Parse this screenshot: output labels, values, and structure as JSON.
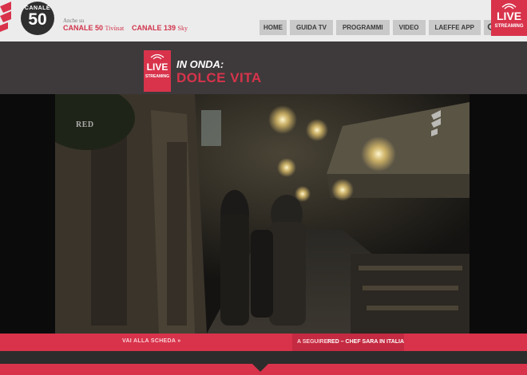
{
  "header": {
    "logo_icon": "la-logo-icon",
    "badge": {
      "top": "CANALE",
      "number": "50"
    },
    "anche_su": "Anche su",
    "channels": [
      {
        "name": "CANALE 50",
        "platform": "Tivùsat"
      },
      {
        "name": "CANALE 139",
        "platform": "Sky"
      }
    ],
    "nav": [
      "HOME",
      "GUIDA TV",
      "PROGRAMMI",
      "VIDEO",
      "LAEFFE APP"
    ],
    "search_icon": "search-icon",
    "live_streaming": {
      "top": "LIVE",
      "bottom": "STREAMING"
    }
  },
  "band": {
    "live_box": {
      "top": "LIVE",
      "bottom": "STREAMING"
    },
    "in_onda": "IN ONDA:",
    "title": "DOLCE VITA"
  },
  "video": {
    "corner_mark": "RED",
    "watermark_icon": "la-watermark-icon"
  },
  "bottom": {
    "vai_alla_scheda": "VAI ALLA SCHEDA »",
    "a_seguire": "A SEGUIRE:",
    "next_show": "RED – CHEF SARA IN ITALIA"
  },
  "colors": {
    "accent": "#d8334b",
    "band": "#3e3a3b",
    "header_bg": "#ececec",
    "nav_bg": "#c9c9c9"
  }
}
